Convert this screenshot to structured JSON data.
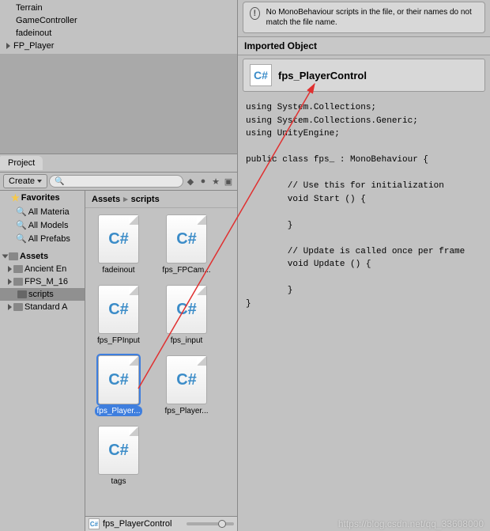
{
  "hierarchy": {
    "items": [
      {
        "label": "Terrain",
        "expandable": false
      },
      {
        "label": "GameController",
        "expandable": false
      },
      {
        "label": "fadeinout",
        "expandable": false
      },
      {
        "label": "FP_Player",
        "expandable": true
      }
    ]
  },
  "project": {
    "tab_label": "Project",
    "create_label": "Create",
    "favorites_label": "Favorites",
    "favorites": [
      "All Materia",
      "All Models",
      "All Prefabs"
    ],
    "assets_label": "Assets",
    "folders": [
      "Ancient En",
      "FPS_M_16",
      "scripts",
      "Standard A"
    ],
    "selected_folder_index": 2,
    "breadcrumb": [
      "Assets",
      "scripts"
    ],
    "files": [
      "fadeinout",
      "fps_FPCam...",
      "fps_FPInput",
      "fps_input",
      "fps_Player...",
      "fps_Player...",
      "tags"
    ],
    "selected_file_index": 4,
    "footer_filename": "fps_PlayerControl"
  },
  "inspector": {
    "warning_text": "No MonoBehaviour scripts in the file, or their names do not match the file name.",
    "section_title": "Imported Object",
    "object_name": "fps_PlayerControl",
    "code": "using System.Collections;\nusing System.Collections.Generic;\nusing UnityEngine;\n\npublic class fps_ : MonoBehaviour {\n\n        // Use this for initialization\n        void Start () {\n\n        }\n\n        // Update is called once per frame\n        void Update () {\n\n        }\n}"
  },
  "watermark": "https://blog.csdn.net/qq_33608000"
}
